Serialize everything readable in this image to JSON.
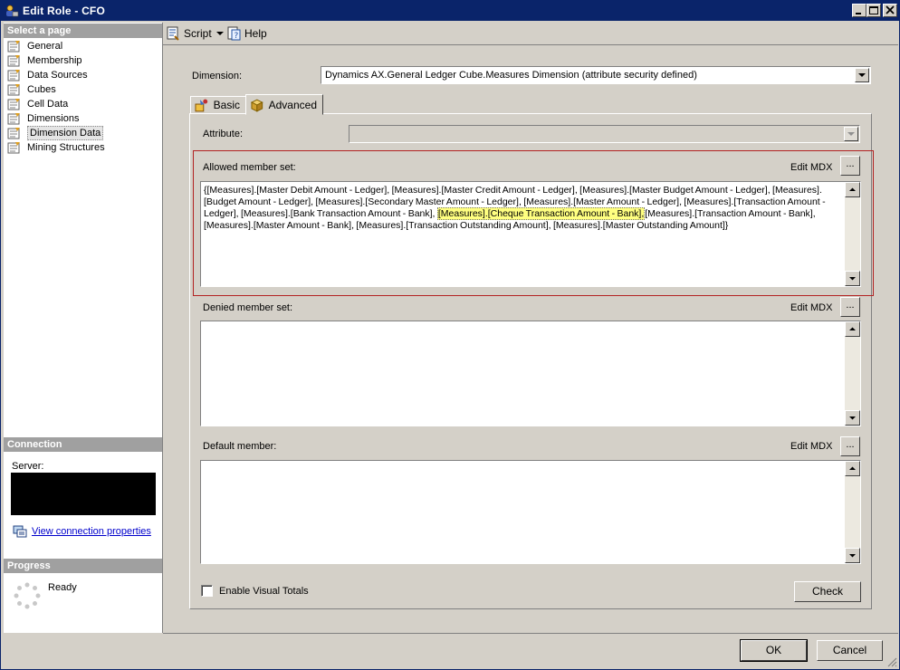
{
  "window": {
    "title": "Edit Role - CFO"
  },
  "sidebar": {
    "select_page_header": "Select a page",
    "items": [
      {
        "label": "General"
      },
      {
        "label": "Membership"
      },
      {
        "label": "Data Sources"
      },
      {
        "label": "Cubes"
      },
      {
        "label": "Cell Data"
      },
      {
        "label": "Dimensions"
      },
      {
        "label": "Dimension Data",
        "selected": true
      },
      {
        "label": "Mining Structures"
      }
    ],
    "connection_header": "Connection",
    "server_label": "Server:",
    "view_connection_link": "View connection properties",
    "progress_header": "Progress",
    "progress_status": "Ready"
  },
  "toolbar": {
    "script_label": "Script",
    "help_label": "Help"
  },
  "form": {
    "dimension_label": "Dimension:",
    "dimension_value": "Dynamics AX.General Ledger Cube.Measures Dimension (attribute security defined)",
    "tabs": [
      {
        "label": "Basic"
      },
      {
        "label": "Advanced",
        "active": true
      }
    ],
    "attribute_label": "Attribute:",
    "attribute_value": "",
    "allowed_label": "Allowed member set:",
    "allowed_text_before": "{[Measures].[Master Debit Amount - Ledger], [Measures].[Master Credit Amount - Ledger], [Measures].[Master Budget Amount - Ledger], [Measures].[Budget Amount - Ledger], [Measures].[Secondary Master Amount - Ledger], [Measures].[Master Amount - Ledger], [Measures].[Transaction Amount - Ledger], [Measures].[Bank Transaction Amount - Bank], ",
    "allowed_text_highlight": "[Measures].[Cheque Transaction Amount - Bank],",
    "allowed_text_after": "[Measures].[Transaction Amount - Bank], [Measures].[Master Amount - Bank], [Measures].[Transaction Outstanding Amount], [Measures].[Master Outstanding Amount]}",
    "denied_label": "Denied member set:",
    "denied_text": "",
    "default_label": "Default member:",
    "default_text": "",
    "edit_mdx_label": "Edit MDX",
    "ellipsis_label": "...",
    "visual_totals_label": "Enable Visual Totals",
    "visual_totals_checked": false,
    "check_label": "Check"
  },
  "footer": {
    "ok_label": "OK",
    "cancel_label": "Cancel"
  },
  "colors": {
    "titlebar": "#0a246a",
    "highlight": "#ffff80",
    "red_outline": "#b22222",
    "link": "#0000cc"
  }
}
